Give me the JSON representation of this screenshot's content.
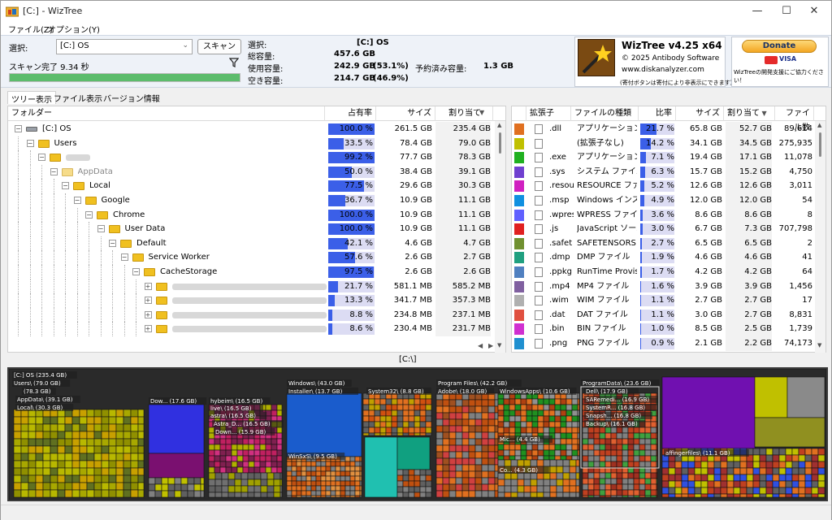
{
  "window": {
    "title": "[C:]  - WizTree"
  },
  "menu": {
    "file": "ファイル(Z)",
    "options": "オプション(Y)"
  },
  "toolbar": {
    "select_label": "選択:",
    "drive_value": "[C:] OS",
    "scan_button": "スキャン",
    "scan_status": "スキャン完了 9.34 秒",
    "progress_fraction": 1.0
  },
  "info": {
    "selected_label": "選択:",
    "selected_value": "[C:]  OS",
    "total_label": "総容量:",
    "total_value": "457.6 GB",
    "used_label": "使用容量:",
    "used_value": "242.9 GB",
    "used_pct": "(53.1%)",
    "reserved_label": "予約済み容量:",
    "reserved_value": "1.3 GB",
    "free_label": "空き容量:",
    "free_value": "214.7 GB",
    "free_pct": "(46.9%)"
  },
  "about": {
    "name": "WizTree v4.25 x64",
    "copyright": "© 2025 Antibody Software",
    "url": "www.diskanalyzer.com",
    "note": "(寄付ボタンは寄付により非表示にできます)",
    "donate": "Donate",
    "card1": "",
    "card2": "VISA",
    "support": "WizTreeの開発支援にご協力ください！"
  },
  "tabs": [
    "ツリー表示",
    "ファイル表示",
    "バージョン情報"
  ],
  "tree": {
    "headers": {
      "folder": "フォルダー",
      "share": "占有率",
      "size": "サイズ",
      "alloc": "割り当て"
    },
    "rows": [
      {
        "indent": 0,
        "exp": "−",
        "name": "[C:] OS",
        "pct": "100.0 %",
        "fill": 1.0,
        "size": "261.5 GB",
        "alloc": "235.4 GB",
        "kind": "drive"
      },
      {
        "indent": 1,
        "exp": "−",
        "name": "Users",
        "pct": "33.5 %",
        "fill": 0.335,
        "size": "78.4 GB",
        "alloc": "79.0 GB",
        "kind": "folder"
      },
      {
        "indent": 2,
        "exp": "−",
        "name": "",
        "pct": "99.2 %",
        "fill": 0.992,
        "size": "77.7 GB",
        "alloc": "78.3 GB",
        "kind": "blurfolder"
      },
      {
        "indent": 3,
        "exp": "−",
        "name": "AppData",
        "pct": "50.0 %",
        "fill": 0.5,
        "size": "38.4 GB",
        "alloc": "39.1 GB",
        "kind": "hiddenfolder"
      },
      {
        "indent": 4,
        "exp": "−",
        "name": "Local",
        "pct": "77.5 %",
        "fill": 0.775,
        "size": "29.6 GB",
        "alloc": "30.3 GB",
        "kind": "folder"
      },
      {
        "indent": 5,
        "exp": "−",
        "name": "Google",
        "pct": "36.7 %",
        "fill": 0.367,
        "size": "10.9 GB",
        "alloc": "11.1 GB",
        "kind": "folder"
      },
      {
        "indent": 6,
        "exp": "−",
        "name": "Chrome",
        "pct": "100.0 %",
        "fill": 1.0,
        "size": "10.9 GB",
        "alloc": "11.1 GB",
        "kind": "folder"
      },
      {
        "indent": 7,
        "exp": "−",
        "name": "User Data",
        "pct": "100.0 %",
        "fill": 1.0,
        "size": "10.9 GB",
        "alloc": "11.1 GB",
        "kind": "folder"
      },
      {
        "indent": 8,
        "exp": "−",
        "name": "Default",
        "pct": "42.1 %",
        "fill": 0.421,
        "size": "4.6 GB",
        "alloc": "4.7 GB",
        "kind": "folder"
      },
      {
        "indent": 9,
        "exp": "−",
        "name": "Service Worker",
        "pct": "57.6 %",
        "fill": 0.576,
        "size": "2.6 GB",
        "alloc": "2.7 GB",
        "kind": "folder"
      },
      {
        "indent": 10,
        "exp": "−",
        "name": "CacheStorage",
        "pct": "97.5 %",
        "fill": 0.975,
        "size": "2.6 GB",
        "alloc": "2.6 GB",
        "kind": "folder"
      },
      {
        "indent": 11,
        "exp": "+",
        "name": "",
        "pct": "21.7 %",
        "fill": 0.217,
        "size": "581.1 MB",
        "alloc": "585.2 MB",
        "kind": "blurfolder"
      },
      {
        "indent": 11,
        "exp": "+",
        "name": "",
        "pct": "13.3 %",
        "fill": 0.133,
        "size": "341.7 MB",
        "alloc": "357.3 MB",
        "kind": "blurfolder"
      },
      {
        "indent": 11,
        "exp": "+",
        "name": "",
        "pct": "8.8 %",
        "fill": 0.088,
        "size": "234.8 MB",
        "alloc": "237.1 MB",
        "kind": "blurfolder"
      },
      {
        "indent": 11,
        "exp": "+",
        "name": "",
        "pct": "8.6 %",
        "fill": 0.086,
        "size": "230.4 MB",
        "alloc": "231.7 MB",
        "kind": "blurfolder"
      }
    ]
  },
  "ext": {
    "headers": {
      "ext": "拡張子",
      "type": "ファイルの種類",
      "ratio": "比率",
      "size": "サイズ",
      "alloc": "割り当て",
      "count": "ファイル数"
    },
    "rows": [
      {
        "color": "#e07020",
        "ext": ".dll",
        "type": "アプリケーション拡",
        "ratio": "21.7 %",
        "fill": 0.217,
        "size": "65.8 GB",
        "alloc": "52.7 GB",
        "count": "89,614"
      },
      {
        "color": "#c0c000",
        "ext": "",
        "type": "(拡張子なし)",
        "ratio": "14.2 %",
        "fill": 0.142,
        "size": "34.1 GB",
        "alloc": "34.5 GB",
        "count": "275,935"
      },
      {
        "color": "#20b020",
        "ext": ".exe",
        "type": "アプリケーション",
        "ratio": "7.1 %",
        "fill": 0.071,
        "size": "19.4 GB",
        "alloc": "17.1 GB",
        "count": "11,078"
      },
      {
        "color": "#7040d0",
        "ext": ".sys",
        "type": "システム ファイル",
        "ratio": "6.3 %",
        "fill": 0.063,
        "size": "15.7 GB",
        "alloc": "15.2 GB",
        "count": "4,750"
      },
      {
        "color": "#d020c0",
        "ext": ".resou",
        "type": "RESOURCE ファイ",
        "ratio": "5.2 %",
        "fill": 0.052,
        "size": "12.6 GB",
        "alloc": "12.6 GB",
        "count": "3,011"
      },
      {
        "color": "#1090e0",
        "ext": ".msp",
        "type": "Windows インスト",
        "ratio": "4.9 %",
        "fill": 0.049,
        "size": "12.0 GB",
        "alloc": "12.0 GB",
        "count": "54"
      },
      {
        "color": "#6060ff",
        "ext": ".wpres",
        "type": "WPRESS ファイル",
        "ratio": "3.6 %",
        "fill": 0.036,
        "size": "8.6 GB",
        "alloc": "8.6 GB",
        "count": "8"
      },
      {
        "color": "#e02020",
        "ext": ".js",
        "type": "JavaScript ソース",
        "ratio": "3.0 %",
        "fill": 0.03,
        "size": "6.7 GB",
        "alloc": "7.3 GB",
        "count": "707,798"
      },
      {
        "color": "#709030",
        "ext": ".safet",
        "type": "SAFETENSORS フ",
        "ratio": "2.7 %",
        "fill": 0.027,
        "size": "6.5 GB",
        "alloc": "6.5 GB",
        "count": "2"
      },
      {
        "color": "#20a080",
        "ext": ".dmp",
        "type": "DMP ファイル",
        "ratio": "1.9 %",
        "fill": 0.019,
        "size": "4.6 GB",
        "alloc": "4.6 GB",
        "count": "41"
      },
      {
        "color": "#5080c0",
        "ext": ".ppkg",
        "type": "RunTime Provisi",
        "ratio": "1.7 %",
        "fill": 0.017,
        "size": "4.2 GB",
        "alloc": "4.2 GB",
        "count": "64"
      },
      {
        "color": "#8060a0",
        "ext": ".mp4",
        "type": "MP4 ファイル",
        "ratio": "1.6 %",
        "fill": 0.016,
        "size": "3.9 GB",
        "alloc": "3.9 GB",
        "count": "1,456"
      },
      {
        "color": "#b0b0b0",
        "ext": ".wim",
        "type": "WIM ファイル",
        "ratio": "1.1 %",
        "fill": 0.011,
        "size": "2.7 GB",
        "alloc": "2.7 GB",
        "count": "17"
      },
      {
        "color": "#e05040",
        "ext": ".dat",
        "type": "DAT ファイル",
        "ratio": "1.1 %",
        "fill": 0.011,
        "size": "3.0 GB",
        "alloc": "2.7 GB",
        "count": "8,831"
      },
      {
        "color": "#d030d0",
        "ext": ".bin",
        "type": "BIN ファイル",
        "ratio": "1.0 %",
        "fill": 0.01,
        "size": "8.5 GB",
        "alloc": "2.5 GB",
        "count": "1,739"
      },
      {
        "color": "#2090d0",
        "ext": ".png",
        "type": "PNG ファイル",
        "ratio": "0.9 %",
        "fill": 0.009,
        "size": "2.1 GB",
        "alloc": "2.2 GB",
        "count": "74,173"
      }
    ]
  },
  "treemap": {
    "path": "[C:\\]",
    "labels": [
      "[C:] OS (235.4 GB)",
      "Users\\ (79.0 GB)",
      "(78.3 GB)",
      "AppData\\ (39.1 GB)",
      "Local\\ (30.3 GB)",
      "Dow... (17.6 GB)",
      "hybeim\\ (16.5 GB)",
      "live\\ (16.5 GB)",
      "astra\\ (16.5 GB)",
      "Astra_D... (16.5 GB)",
      "Down... (15.9 GB)",
      "Windows\\ (43.0 GB)",
      "Installer\\ (13.7 GB)",
      "System32\\ (8.8 GB)",
      "WinSxS\\ (9.5 GB)",
      "Program Files\\ (42.2 GB)",
      "Adobe\\ (18.0 GB)",
      "WindowsApps\\ (10.6 GB)",
      "Mic... (4.4 GB)",
      "Co... (4.3 GB)",
      "ProgramData\\ (23.6 GB)",
      "Dell\\ (17.9 GB)",
      "SARemedi... (16.9 GB)",
      "SystemR... (16.8 GB)",
      "Snapsh... (16.8 GB)",
      "Backup\\ (16.1 GB)",
      "affingerfiles\\ (11.1 GB)"
    ]
  }
}
